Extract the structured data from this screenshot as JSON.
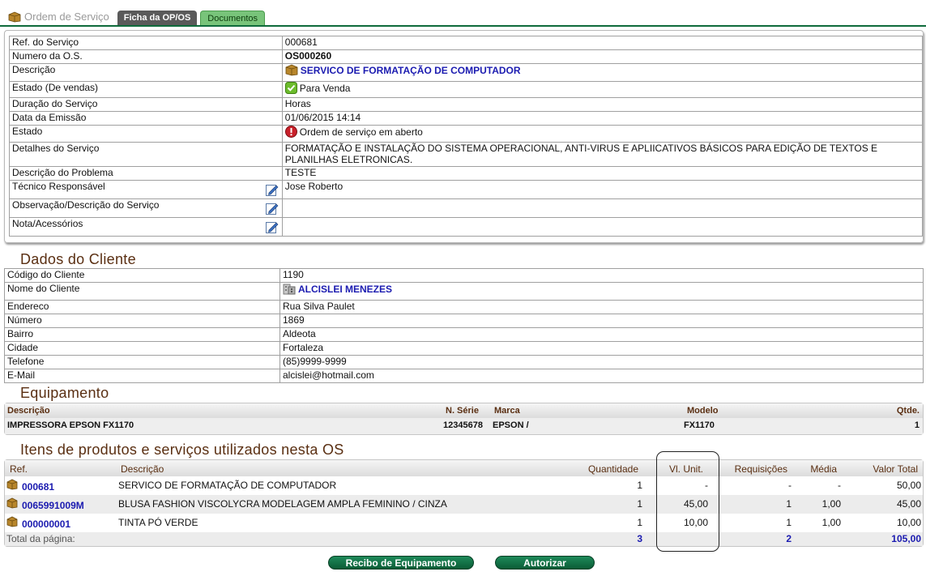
{
  "tabs": {
    "title": "Ordem de Serviço",
    "active": "Ficha da OP/OS",
    "documents": "Documentos"
  },
  "service": {
    "ref_label": "Ref. do Serviço",
    "ref_value": "000681",
    "os_label": "Numero da O.S.",
    "os_value": "OS000260",
    "desc_label": "Descrição",
    "desc_value": "SERVICO DE FORMATAÇÃO DE COMPUTADOR",
    "sales_state_label": "Estado (De vendas)",
    "sales_state_value": "Para Venda",
    "duration_label": "Duração do Serviço",
    "duration_value": "Horas",
    "date_label": "Data da Emissão",
    "date_value": "01/06/2015 14:14",
    "state_label": "Estado",
    "state_value": "Ordem de serviço em aberto",
    "details_label": "Detalhes do Serviço",
    "details_value": "FORMATAÇÃO E INSTALAÇÃO DO SISTEMA OPERACIONAL, ANTI-VIRUS E APLIICATIVOS BÁSICOS PARA EDIÇÃO DE TEXTOS E PLANILHAS ELETRONICAS.",
    "problem_label": "Descrição do Problema",
    "problem_value": "TESTE",
    "tech_label": "Técnico Responsável",
    "tech_value": "Jose Roberto",
    "obs_label": "Observação/Descrição do Serviço",
    "obs_value": "",
    "notes_label": "Nota/Acessórios",
    "notes_value": ""
  },
  "client": {
    "title": "Dados do Cliente",
    "code_label": "Código do Cliente",
    "code_value": "1190",
    "name_label": "Nome do Cliente",
    "name_value": "ALCISLEI MENEZES",
    "address_label": "Endereco",
    "address_value": "Rua Silva Paulet",
    "number_label": "Número",
    "number_value": "1869",
    "district_label": "Bairro",
    "district_value": "Aldeota",
    "city_label": "Cidade",
    "city_value": "Fortaleza",
    "phone_label": "Telefone",
    "phone_value": "(85)9999-9999",
    "email_label": "E-Mail",
    "email_value": "alcislei@hotmail.com"
  },
  "equipment": {
    "title": "Equipamento",
    "headers": {
      "desc": "Descrição",
      "serial": "N. Série",
      "brand": "Marca",
      "model": "Modelo",
      "qty": "Qtde."
    },
    "row": {
      "desc": "IMPRESSORA EPSON FX1170",
      "serial": "12345678",
      "brand": "EPSON /",
      "model": "FX1170",
      "qty": "1"
    }
  },
  "items": {
    "title": "Itens de produtos e serviços utilizados nesta OS",
    "headers": {
      "ref": "Ref.",
      "desc": "Descrição",
      "qty": "Quantidade",
      "unit": "Vl. Unit.",
      "req": "Requisições",
      "avg": "Média",
      "total": "Valor Total"
    },
    "rows": [
      {
        "ref": "000681",
        "desc": "SERVICO DE FORMATAÇÃO DE COMPUTADOR",
        "qty": "1",
        "unit": "-",
        "req": "-",
        "avg": "-",
        "total": "50,00"
      },
      {
        "ref": "0065991009M",
        "desc": "BLUSA FASHION VISCOLYCRA MODELAGEM AMPLA FEMININO / CINZA",
        "qty": "1",
        "unit": "45,00",
        "req": "1",
        "avg": "1,00",
        "total": "45,00"
      },
      {
        "ref": "000000001",
        "desc": "TINTA PÓ VERDE",
        "qty": "1",
        "unit": "10,00",
        "req": "1",
        "avg": "1,00",
        "total": "10,00"
      }
    ],
    "footer": {
      "label": "Total da página:",
      "qty": "3",
      "req": "2",
      "total": "105,00"
    }
  },
  "buttons": {
    "receipt": "Recibo de Equipamento",
    "authorize": "Autorizar"
  },
  "colors": {
    "accent_green": "#0f6b3b",
    "section_brown": "#5a2f12",
    "link_blue": "#1b1bb0"
  }
}
